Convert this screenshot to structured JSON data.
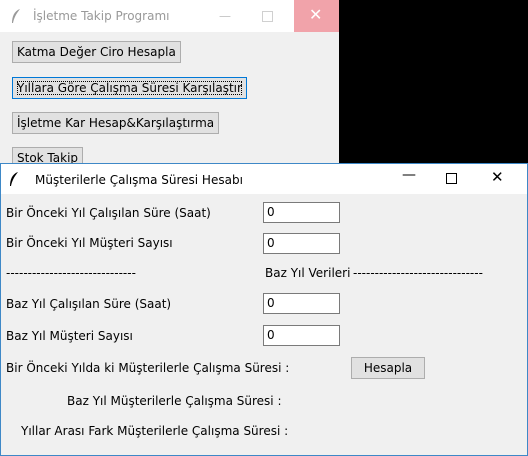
{
  "main_window": {
    "title": "İşletme Takip Programı",
    "buttons": [
      "Katma Değer Ciro Hesapla",
      "Yıllara Göre Çalışma Süresi Karşılaştır",
      "İşletme Kar Hesap&Karşılaştırma",
      "Stok Takip"
    ]
  },
  "dialog": {
    "title": "Müşterilerle Çalışma Süresi Hesabı",
    "prev_hours_label": "Bir Önceki Yıl Çalışılan Süre (Saat)",
    "prev_hours_value": "0",
    "prev_customers_label": "Bir Önceki Yıl Müşteri Sayısı",
    "prev_customers_value": "0",
    "separator_left": "------------------------------",
    "base_year_header": "Baz Yıl Verileri",
    "separator_right": "------------------------------",
    "base_hours_label": "Baz Yıl Çalışılan Süre (Saat)",
    "base_hours_value": "0",
    "base_customers_label": "Baz Yıl Müşteri Sayısı",
    "base_customers_value": "0",
    "prev_result_label": "Bir Önceki Yılda ki Müşterilerle Çalışma Süresi :",
    "calculate_button": "Hesapla",
    "base_result_label": "Baz Yıl Müşterilerle Çalışma Süresi :",
    "diff_result_label": "Yıllar Arası Fark Müşterilerle Çalışma Süresi :"
  }
}
